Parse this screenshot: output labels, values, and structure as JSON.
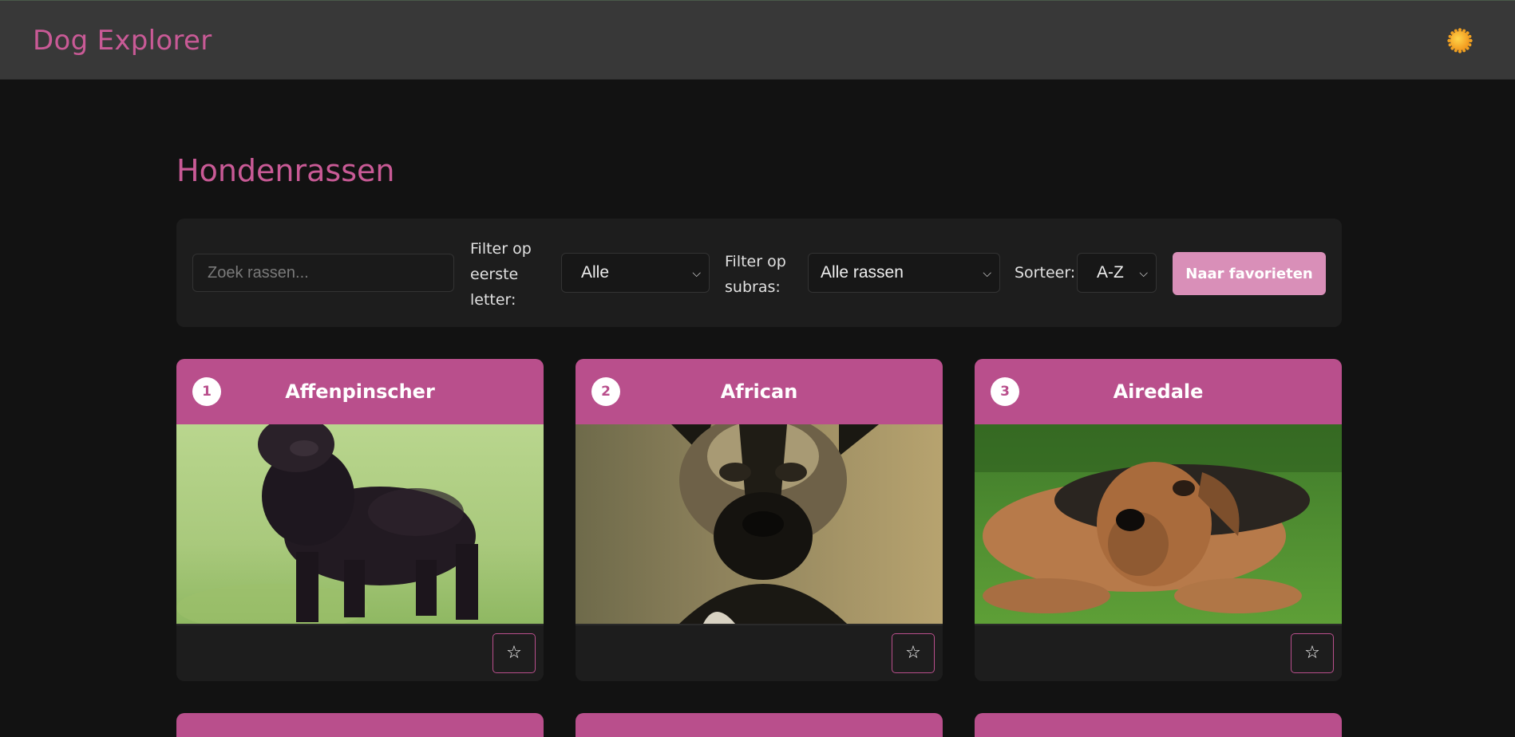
{
  "app": {
    "brand": "Dog Explorer",
    "theme_icon": "sun-icon",
    "accent_color": "#c95a96"
  },
  "page": {
    "title": "Hondenrassen"
  },
  "filters": {
    "search_placeholder": "Zoek rassen...",
    "letter_label_1": "Filter op",
    "letter_label_2": "eerste",
    "letter_label_3": "letter:",
    "letter_value": "Alle",
    "subbreed_label_1": "Filter op",
    "subbreed_label_2": "subras:",
    "subbreed_value": "Alle rassen",
    "sort_label": "Sorteer:",
    "sort_value": "A-Z",
    "favorites_button": "Naar favorieten"
  },
  "breeds": [
    {
      "number": "1",
      "name": "Affenpinscher",
      "favorite_icon": "☆"
    },
    {
      "number": "2",
      "name": "African",
      "favorite_icon": "☆"
    },
    {
      "number": "3",
      "name": "Airedale",
      "favorite_icon": "☆"
    }
  ]
}
